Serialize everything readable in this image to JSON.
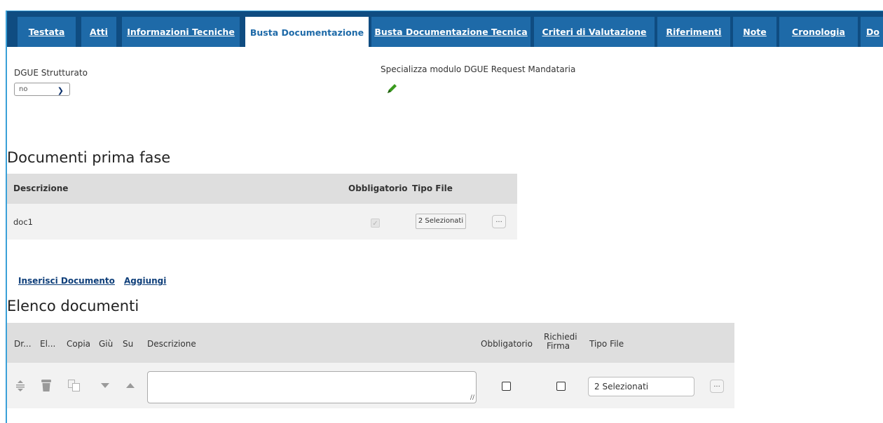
{
  "tabs": [
    {
      "label": "Testata",
      "active": false
    },
    {
      "label": "Atti",
      "active": false
    },
    {
      "label": "Informazioni Tecniche",
      "active": false
    },
    {
      "label": "Busta Documentazione",
      "active": true
    },
    {
      "label": "Busta Documentazione Tecnica",
      "active": false
    },
    {
      "label": "Criteri di Valutazione",
      "active": false
    },
    {
      "label": "Riferimenti",
      "active": false
    },
    {
      "label": "Note",
      "active": false
    },
    {
      "label": "Cronologia",
      "active": false
    },
    {
      "label": "Do",
      "active": false
    }
  ],
  "dgue": {
    "label": "DGUE Strutturato",
    "value": "no",
    "specialize_label": "Specializza modulo DGUE Request Mandataria"
  },
  "first_phase": {
    "title": "Documenti prima fase",
    "headers": {
      "description": "Descrizione",
      "mandatory": "Obbligatorio",
      "file_type": "Tipo File"
    },
    "rows": [
      {
        "description": "doc1",
        "mandatory": true,
        "file_type": "2 Selezionati",
        "more": "..."
      }
    ]
  },
  "actions": {
    "insert_document": "Inserisci Documento",
    "add": "Aggiungi"
  },
  "document_list": {
    "title": "Elenco documenti",
    "headers": {
      "drag": "Dr...",
      "delete": "El...",
      "copy": "Copia",
      "down": "Giù",
      "up": "Su",
      "description": "Descrizione",
      "mandatory": "Obbligatorio",
      "require_signature_1": "Richiedi",
      "require_signature_2": "Firma",
      "file_type": "Tipo File"
    },
    "rows": [
      {
        "description": "",
        "mandatory": false,
        "require_signature": false,
        "file_type": "2 Selezionati",
        "more": "..."
      }
    ]
  },
  "colors": {
    "tab_bar": "#0f4c81",
    "tab": "#1e6aa8",
    "link": "#0f3f7a",
    "frame": "#3aa0d8"
  }
}
